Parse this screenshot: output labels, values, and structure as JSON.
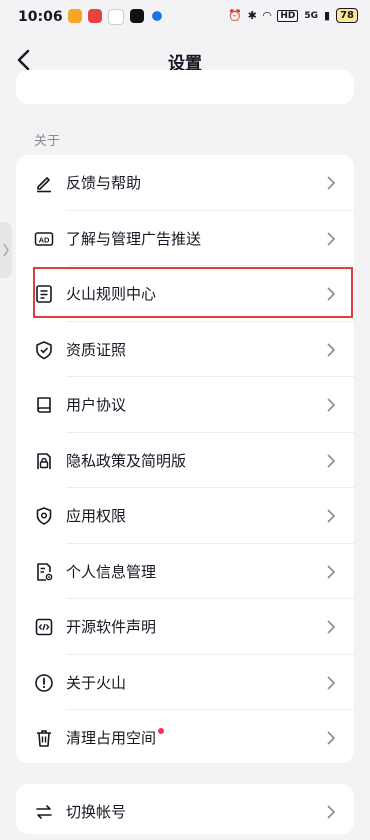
{
  "status_bar": {
    "time": "10:06",
    "network": "HD",
    "signal": "5G",
    "battery": "78"
  },
  "nav": {
    "title": "设置"
  },
  "section": {
    "about_label": "关于"
  },
  "items": [
    {
      "label": "反馈与帮助",
      "icon": "edit-icon"
    },
    {
      "label": "了解与管理广告推送",
      "icon": "ad-icon"
    },
    {
      "label": "火山规则中心",
      "icon": "document-icon"
    },
    {
      "label": "资质证照",
      "icon": "shield-check-icon"
    },
    {
      "label": "用户协议",
      "icon": "book-icon"
    },
    {
      "label": "隐私政策及简明版",
      "icon": "lock-doc-icon"
    },
    {
      "label": "应用权限",
      "icon": "location-shield-icon"
    },
    {
      "label": "个人信息管理",
      "icon": "doc-settings-icon"
    },
    {
      "label": "开源软件声明",
      "icon": "code-icon"
    },
    {
      "label": "关于火山",
      "icon": "info-icon"
    },
    {
      "label": "清理占用空间",
      "icon": "trash-icon"
    }
  ],
  "bottom_item": {
    "label": "切换帐号",
    "icon": "switch-icon"
  },
  "colors": {
    "highlight": "#e03e3e",
    "badge": "#fe2c55"
  }
}
